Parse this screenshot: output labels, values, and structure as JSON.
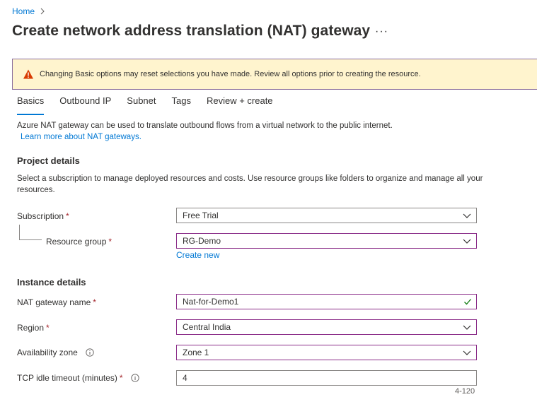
{
  "breadcrumb": {
    "home": "Home"
  },
  "title": "Create network address translation (NAT) gateway",
  "more": "···",
  "banner": {
    "text": "Changing Basic options may reset selections you have made. Review all options prior to creating the resource."
  },
  "tabs": [
    {
      "label": "Basics"
    },
    {
      "label": "Outbound IP"
    },
    {
      "label": "Subnet"
    },
    {
      "label": "Tags"
    },
    {
      "label": "Review + create"
    }
  ],
  "intro": {
    "text": "Azure NAT gateway can be used to translate outbound flows from a virtual network to the public internet.",
    "link": "Learn more about NAT gateways."
  },
  "project": {
    "heading": "Project details",
    "desc": "Select a subscription to manage deployed resources and costs. Use resource groups like folders to organize and manage all your resources.",
    "subscription_label": "Subscription",
    "subscription_value": "Free Trial",
    "rg_label": "Resource group",
    "rg_value": "RG-Demo",
    "create_new": "Create new"
  },
  "instance": {
    "heading": "Instance details",
    "name_label": "NAT gateway name",
    "name_value": "Nat-for-Demo1",
    "region_label": "Region",
    "region_value": "Central India",
    "zone_label": "Availability zone",
    "zone_value": "Zone 1",
    "timeout_label": "TCP idle timeout (minutes)",
    "timeout_value": "4",
    "timeout_hint": "4-120"
  },
  "required_mark": "*",
  "colors": {
    "accent": "#0078d4",
    "focus_border": "#8a2c88",
    "warning_bg": "#fff4ce",
    "required": "#a4262c"
  }
}
